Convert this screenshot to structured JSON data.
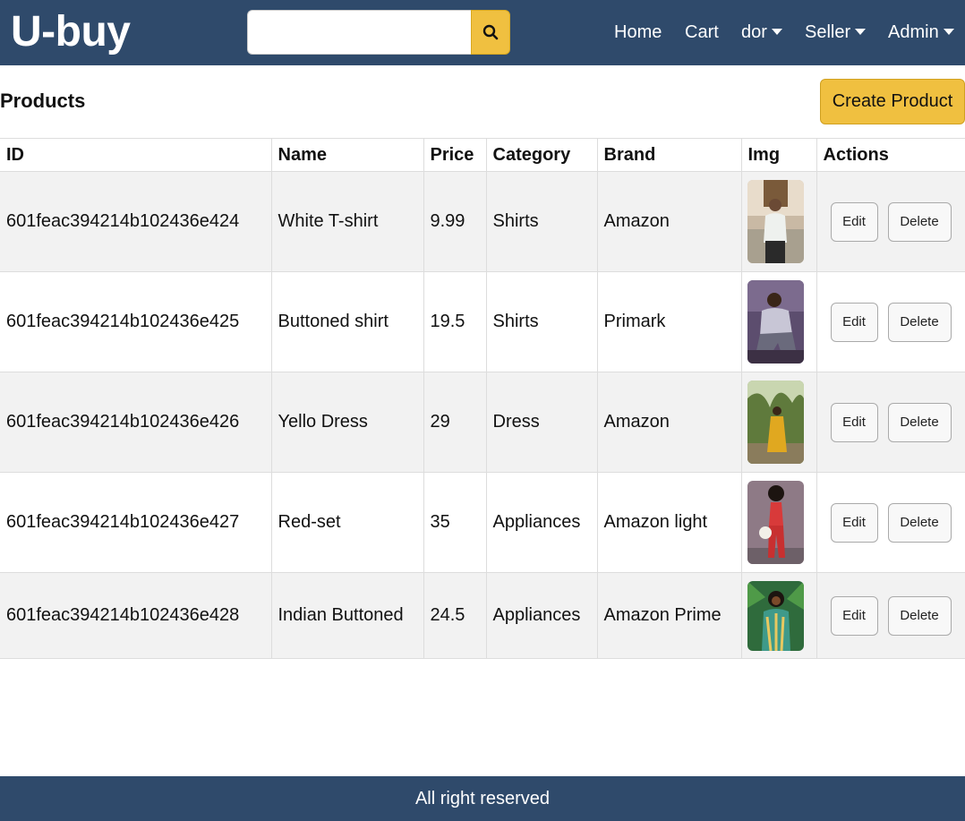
{
  "header": {
    "brand": "U-buy",
    "search": {
      "value": "",
      "placeholder": ""
    },
    "nav": {
      "home": "Home",
      "cart": "Cart",
      "user": "dor",
      "seller": "Seller",
      "admin": "Admin"
    }
  },
  "page": {
    "title": "Products",
    "create_button": "Create Product"
  },
  "table": {
    "columns": [
      "ID",
      "Name",
      "Price",
      "Category",
      "Brand",
      "Img",
      "Actions"
    ],
    "rows": [
      {
        "id": "601feac394214b102436e424",
        "name": "White T-shirt",
        "price": "9.99",
        "category": "Shirts",
        "brand": "Amazon",
        "edit": "Edit",
        "delete": "Delete"
      },
      {
        "id": "601feac394214b102436e425",
        "name": "Buttoned shirt",
        "price": "19.5",
        "category": "Shirts",
        "brand": "Primark",
        "edit": "Edit",
        "delete": "Delete"
      },
      {
        "id": "601feac394214b102436e426",
        "name": "Yello Dress",
        "price": "29",
        "category": "Dress",
        "brand": "Amazon",
        "edit": "Edit",
        "delete": "Delete"
      },
      {
        "id": "601feac394214b102436e427",
        "name": "Red-set",
        "price": "35",
        "category": "Appliances",
        "brand": "Amazon light",
        "edit": "Edit",
        "delete": "Delete"
      },
      {
        "id": "601feac394214b102436e428",
        "name": "Indian Buttoned",
        "price": "24.5",
        "category": "Appliances",
        "brand": "Amazon Prime",
        "edit": "Edit",
        "delete": "Delete"
      }
    ]
  },
  "footer": {
    "text": "All right reserved"
  },
  "colors": {
    "navbar": "#2f4a6b",
    "accent": "#f0c040",
    "row_stripe": "#f2f2f2"
  },
  "icons": {
    "search": "search-icon",
    "dropdown": "caret-down-icon"
  }
}
